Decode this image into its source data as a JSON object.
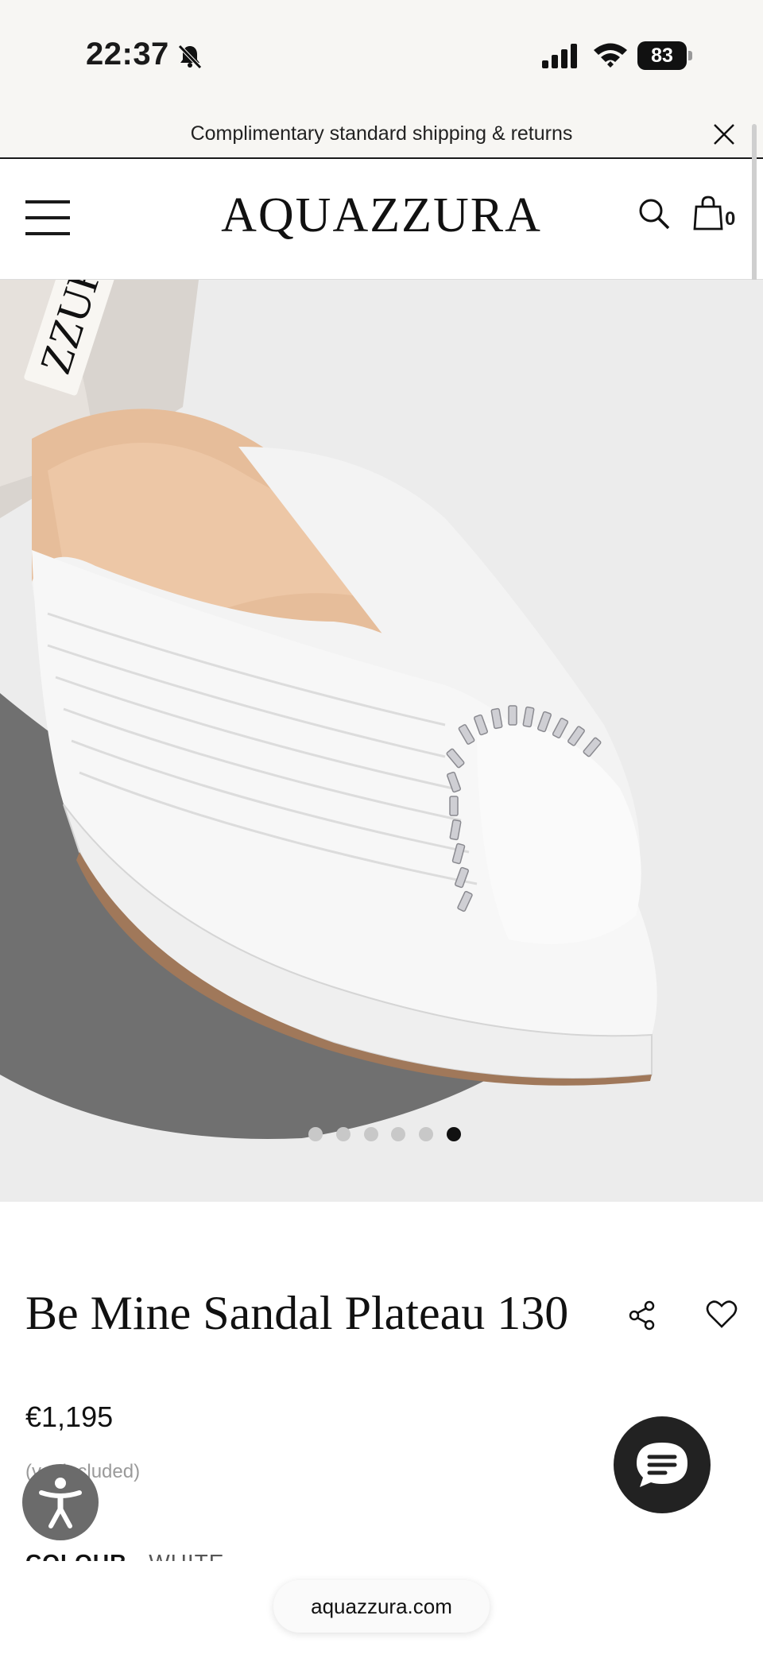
{
  "status_bar": {
    "time": "22:37",
    "battery": "83"
  },
  "promo": {
    "text": "Complimentary standard shipping & returns"
  },
  "header": {
    "logo": "AQUAZZURA",
    "bag_count": "0"
  },
  "product": {
    "image_brand_label": "ZZURA",
    "gallery": {
      "total_images": 6,
      "active_index": 5
    },
    "title": "Be Mine Sandal Plateau 130",
    "price": "€1,195",
    "vat_note": "(vat included)",
    "colour_label": "COLOUR",
    "colour_value": "WHITE"
  },
  "browser": {
    "url": "aquazzura.com"
  },
  "icons": {
    "notifications": "bell-slash-icon",
    "close": "close-icon",
    "menu": "hamburger-menu-icon",
    "search": "search-icon",
    "bag": "shopping-bag-icon",
    "share": "share-icon",
    "wishlist": "heart-icon",
    "accessibility": "accessibility-icon",
    "chat": "chat-icon"
  },
  "colors": {
    "background": "#ffffff",
    "banner": "#f7f6f3",
    "text": "#1a1a1a",
    "chat_button": "#222222"
  }
}
